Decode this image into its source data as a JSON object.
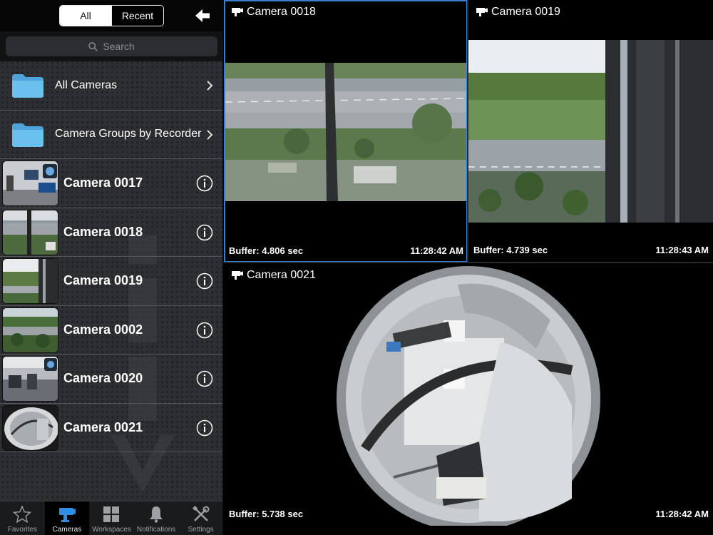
{
  "sidebar": {
    "filter": {
      "all_label": "All",
      "recent_label": "Recent",
      "selected": "All"
    },
    "search": {
      "placeholder": "Search"
    },
    "folders": [
      {
        "label": "All Cameras"
      },
      {
        "label": "Camera Groups by Recorder"
      }
    ],
    "cameras": [
      {
        "label": "Camera 0017",
        "thumb": "office"
      },
      {
        "label": "Camera 0018",
        "thumb": "street"
      },
      {
        "label": "Camera 0019",
        "thumb": "field"
      },
      {
        "label": "Camera 0002",
        "thumb": "trees"
      },
      {
        "label": "Camera 0020",
        "thumb": "office2"
      },
      {
        "label": "Camera 0021",
        "thumb": "fisheye"
      }
    ]
  },
  "tabbar": {
    "tabs": [
      {
        "label": "Favorites",
        "icon": "star-icon",
        "active": false
      },
      {
        "label": "Cameras",
        "icon": "camera-icon",
        "active": true
      },
      {
        "label": "Workspaces",
        "icon": "grid-icon",
        "active": false
      },
      {
        "label": "Notifications",
        "icon": "bell-icon",
        "active": false
      },
      {
        "label": "Settings",
        "icon": "tools-icon",
        "active": false
      }
    ]
  },
  "tiles": [
    {
      "title": "Camera 0018",
      "buffer": "Buffer: 4.806 sec",
      "time": "11:28:42 AM",
      "selected": true
    },
    {
      "title": "Camera 0019",
      "buffer": "Buffer: 4.739 sec",
      "time": "11:28:43 AM",
      "selected": false
    },
    {
      "title": "Camera 0021",
      "buffer": "Buffer: 5.738 sec",
      "time": "11:28:42 AM",
      "selected": false
    }
  ],
  "colors": {
    "accent": "#3b7fd0",
    "sidebar_bg": "#2e2f33",
    "folder": "#5ab4e6"
  }
}
